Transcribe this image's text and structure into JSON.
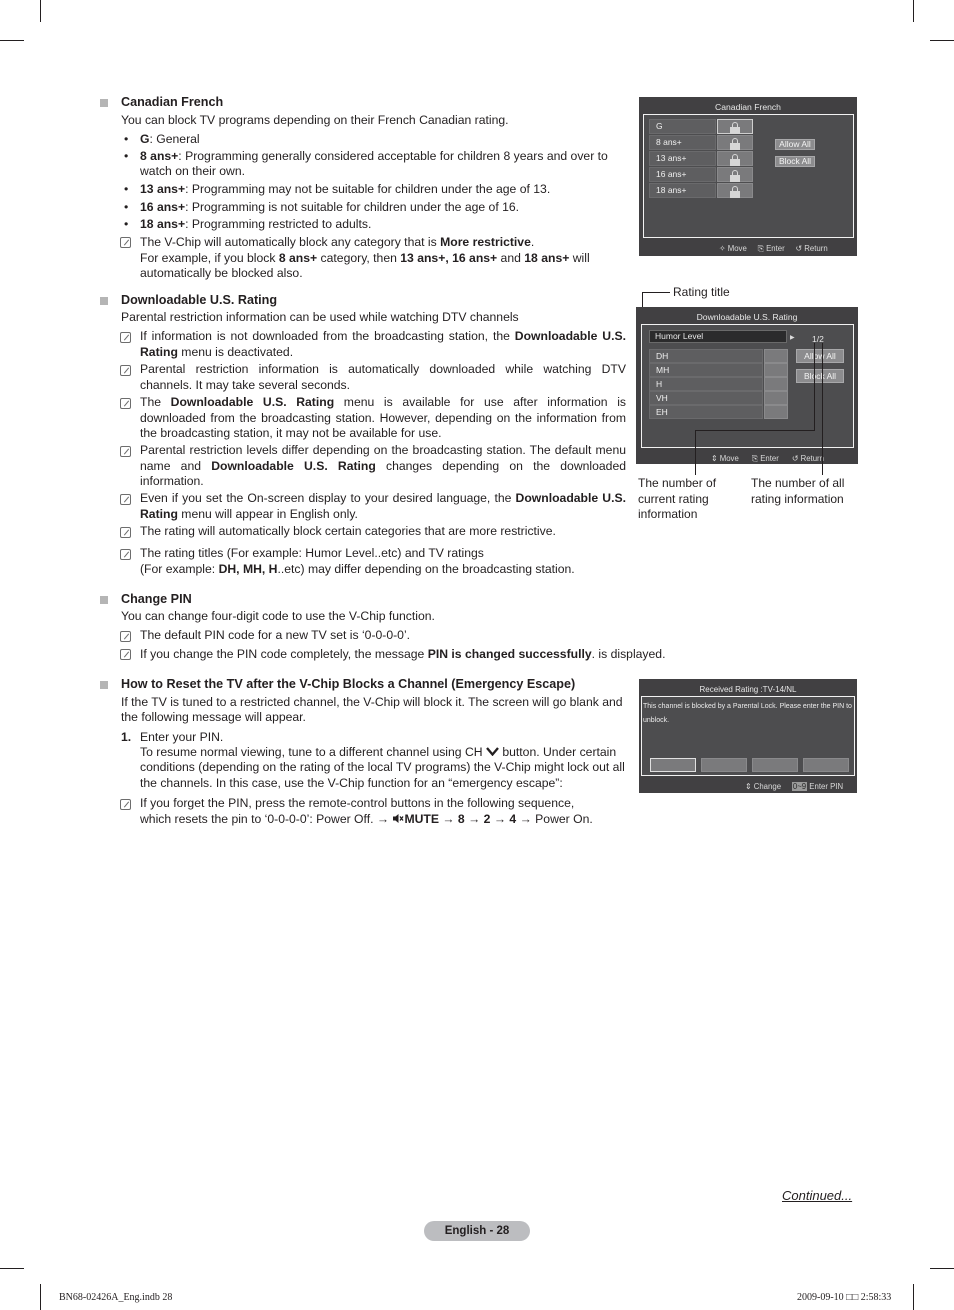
{
  "sections": {
    "canadian_french": {
      "title": "Canadian French",
      "intro": "You can block TV programs depending on their French Canadian rating.",
      "bullets": [
        {
          "term": "G",
          "text": ": General"
        },
        {
          "term": "8 ans+",
          "text": ": Programming generally considered acceptable for children 8 years and over to",
          "cont": "watch on their own."
        },
        {
          "term": "13 ans+",
          "text": ": Programming may not be suitable for children under the age of 13."
        },
        {
          "term": "16 ans+",
          "text": ": Programming is not suitable for children under the age of 16."
        },
        {
          "term": "18 ans+",
          "text": ": Programming restricted to adults."
        }
      ],
      "note": {
        "l1a": "The V-Chip will automatically block any category that is ",
        "l1b": "More restrictive",
        "l1c": ".",
        "l2a": "For example, if you block ",
        "l2b": "8 ans+",
        "l2c": " category, then ",
        "l2d": "13 ans+, 16 ans+",
        "l2e": " and ",
        "l2f": "18 ans+",
        "l2g": " will",
        "l3": "automatically be blocked also."
      }
    },
    "downloadable": {
      "title": "Downloadable U.S. Rating",
      "intro": "Parental restriction information can be used while watching DTV channels",
      "n1a": "If information is not downloaded from the broadcasting station, the ",
      "n1b": "Downloadable U.S. Rating",
      "n1c": " menu is deactivated.",
      "n2": "Parental restriction information is automatically downloaded while watching DTV channels. It may take several seconds.",
      "n3a": "The ",
      "n3b": "Downloadable U.S. Rating",
      "n3c": " menu is available for use after information is downloaded from the broadcasting station. However, depending on the information from the broadcasting station, it may not be available for use.",
      "n4a": "Parental restriction levels differ depending on the broadcasting station. The default menu name and ",
      "n4b": "Downloadable U.S. Rating",
      "n4c": " changes depending on the downloaded information.",
      "n5a": "Even if you set the On-screen display to your desired language, the ",
      "n5b": "Downloadable U.S. Rating",
      "n5c": " menu will appear in English only.",
      "n6": "The rating will automatically block certain categories that are more restrictive.",
      "n7l1": "The rating titles (For example: Humor Level..etc) and TV ratings",
      "n7l2a": "(For example: ",
      "n7l2b": "DH, MH, H",
      "n7l2c": "..etc) may differ depending on the broadcasting station."
    },
    "change_pin": {
      "title": "Change PIN",
      "intro": "You can change four-digit code to use the V-Chip function.",
      "n1": "The default PIN code for a new TV set is ‘0-0-0-0’.",
      "n2a": "If you change the PIN code completely, the message ",
      "n2b": "PIN is changed successfully",
      "n2c": ". is displayed."
    },
    "reset": {
      "title": "How to Reset the TV after the V-Chip Blocks a Channel (Emergency Escape)",
      "intro1": "If the TV is tuned to a restricted channel, the V-Chip will block it. The screen will go blank and",
      "intro2": "the following message will appear.",
      "step_num": "1.",
      "step_l1": "Enter your PIN.",
      "step_l2a": "To resume normal viewing, tune to a different channel using CH ",
      "step_l2b": " button. Under certain",
      "step_l3": "conditions (depending on the rating of the local TV programs) the V-Chip might lock out all",
      "step_l4": "the channels. In this case, use the V-Chip function for an “emergency escape”:",
      "note_l1": "If you forget the PIN, press the remote-control buttons in the following sequence,",
      "note_l2a": "which resets the pin to ‘0-0-0-0’: Power Off. → ",
      "note_l2b": "MUTE → 8",
      "note_l2c": " → ",
      "note_l2d": "2",
      "note_l2e": " → ",
      "note_l2f": "4",
      "note_l2g": " → Power On."
    }
  },
  "screens": {
    "canadian": {
      "title": "Canadian French",
      "rows": [
        "G",
        "8 ans+",
        "13 ans+",
        "16 ans+",
        "18 ans+"
      ],
      "allow_all": "Allow All",
      "block_all": "Block All",
      "footer": {
        "move": "Move",
        "enter": "Enter",
        "return": "Return"
      }
    },
    "us_rating": {
      "title": "Downloadable U.S. Rating",
      "rating_title": "Humor Level",
      "page": "1/2",
      "rows": [
        "DH",
        "MH",
        "H",
        "VH",
        "EH"
      ],
      "allow_all": "Allow All",
      "block_all": "Block All",
      "footer": {
        "move": "Move",
        "enter": "Enter",
        "return": "Return"
      },
      "callouts": {
        "rating_title": "Rating title",
        "current_l1": "The number of",
        "current_l2": "current rating",
        "current_l3": "information",
        "all_l1": "The number of all",
        "all_l2": "rating information"
      }
    },
    "blocked": {
      "title": "Received Rating :TV-14/NL",
      "message_l1": "This channel is blocked by a Parental Lock. Please enter the PIN to",
      "message_l2": "unblock.",
      "footer": {
        "change": "Change",
        "keys": "0~9",
        "enter_pin": "Enter PIN"
      }
    }
  },
  "footer": {
    "continued": "Continued...",
    "page_label": "English - 28",
    "slug_left": "BN68-02426A_Eng.indb   28",
    "slug_right": "2009-09-10   □□ 2:58:33"
  }
}
